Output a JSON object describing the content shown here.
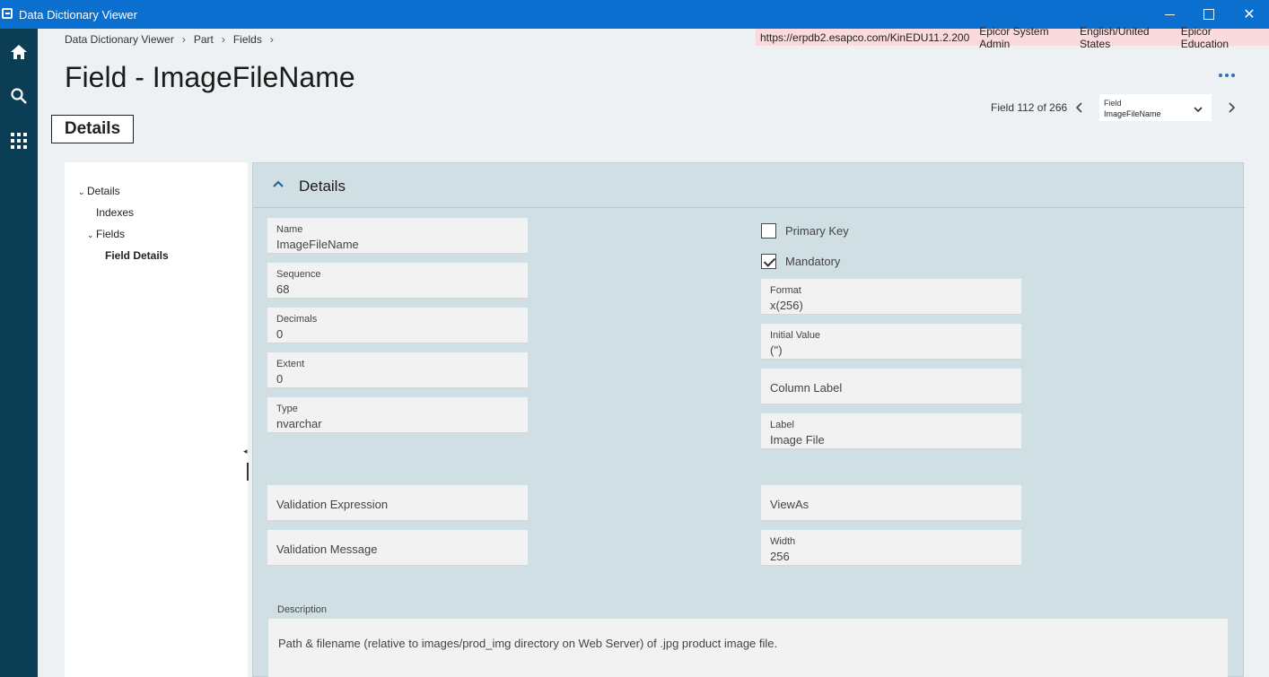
{
  "window": {
    "title": "Data Dictionary Viewer",
    "close_glyph": "✕"
  },
  "rail": {
    "icons": [
      "home-icon",
      "search-icon",
      "apps-grid-icon"
    ]
  },
  "breadcrumb": {
    "items": [
      "Data Dictionary Viewer",
      "Part",
      "Fields"
    ],
    "separator": "›"
  },
  "environment": {
    "url": "https://erpdb2.esapco.com/KinEDU11.2.200",
    "user": "Epicor System Admin",
    "language": "English/United States",
    "company": "Epicor Education"
  },
  "page": {
    "title": "Field - ImageFileName",
    "tab_label": "Details"
  },
  "record_nav": {
    "position_text": "Field 112 of 266",
    "select_label": "Field",
    "select_value": "ImageFileName"
  },
  "tree": {
    "items": [
      "Details",
      "Indexes",
      "Fields",
      "Field Details"
    ]
  },
  "panel": {
    "title": "Details"
  },
  "fields": {
    "name": {
      "label": "Name",
      "value": "ImageFileName"
    },
    "sequence": {
      "label": "Sequence",
      "value": "68"
    },
    "decimals": {
      "label": "Decimals",
      "value": "0"
    },
    "extent": {
      "label": "Extent",
      "value": "0"
    },
    "type": {
      "label": "Type",
      "value": "nvarchar"
    },
    "validation_expression": {
      "label": "Validation Expression"
    },
    "validation_message": {
      "label": "Validation Message"
    },
    "primary_key": {
      "label": "Primary Key",
      "checked": false
    },
    "mandatory": {
      "label": "Mandatory",
      "checked": true
    },
    "format": {
      "label": "Format",
      "value": "x(256)"
    },
    "initial_value": {
      "label": "Initial Value",
      "value": "('')"
    },
    "column_label": {
      "label": "Column Label"
    },
    "label": {
      "label": "Label",
      "value": "Image File"
    },
    "view_as": {
      "label": "ViewAs"
    },
    "width": {
      "label": "Width",
      "value": "256"
    }
  },
  "description": {
    "label": "Description",
    "value": "Path & filename (relative to images/prod_img directory on Web Server) of .jpg product image file."
  },
  "colors": {
    "titlebar": "#0b6fd0",
    "rail": "#0b3d54",
    "panel": "#d0dfe4",
    "env_highlight": "#fadadd",
    "accent": "#2a6fc0"
  }
}
